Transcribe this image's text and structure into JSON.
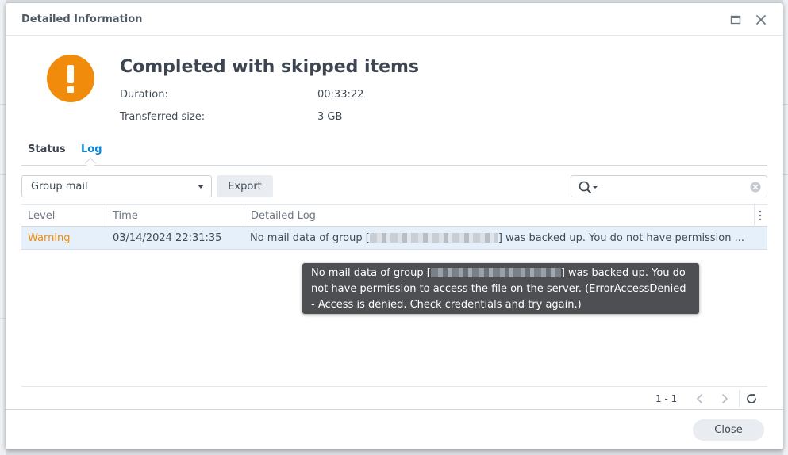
{
  "window": {
    "title": "Detailed Information"
  },
  "summary": {
    "headline": "Completed with skipped items",
    "duration_label": "Duration:",
    "duration_value": "00:33:22",
    "size_label": "Transferred size:",
    "size_value": "3 GB"
  },
  "tabs": [
    {
      "label": "Status",
      "active": false
    },
    {
      "label": "Log",
      "active": true
    }
  ],
  "toolbar": {
    "filter_value": "Group mail",
    "export_label": "Export",
    "search_value": ""
  },
  "grid": {
    "columns": [
      "Level",
      "Time",
      "Detailed Log"
    ],
    "rows": [
      {
        "level": "Warning",
        "time": "03/14/2024 22:31:35",
        "log_prefix": "No mail data of group [",
        "log_suffix": "] was backed up. You do not have permission ..."
      }
    ]
  },
  "tooltip": {
    "line1_prefix": "No mail data of group [",
    "line1_suffix": "] was backed up. You do",
    "line2": "not have permission to access the file on the server. (ErrorAccessDenied",
    "line3": "- Access is denied. Check credentials and try again.)"
  },
  "pager": {
    "count": "1 - 1"
  },
  "footer": {
    "close_label": "Close"
  },
  "colors": {
    "accent": "#0f86d4",
    "warning": "#f08b0c",
    "selected_row": "#e6f0fa",
    "tooltip_bg": "#4d4f52"
  },
  "icons": {
    "status": "warning-exclamation-icon",
    "maximize": "maximize-icon",
    "close": "close-icon",
    "search": "search-icon",
    "clear": "clear-icon",
    "prev": "chevron-left-icon",
    "next": "chevron-right-icon",
    "refresh": "refresh-icon",
    "column_menu": "kebab-menu-icon"
  }
}
